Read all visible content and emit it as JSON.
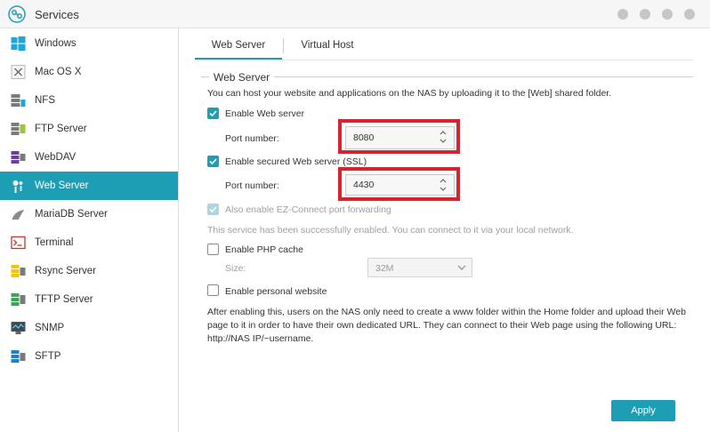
{
  "window": {
    "title": "Services"
  },
  "sidebar": {
    "items": [
      {
        "label": "Windows",
        "icon": "windows-icon"
      },
      {
        "label": "Mac OS X",
        "icon": "mac-os-x-icon"
      },
      {
        "label": "NFS",
        "icon": "nfs-icon"
      },
      {
        "label": "FTP Server",
        "icon": "ftp-server-icon"
      },
      {
        "label": "WebDAV",
        "icon": "webdav-icon"
      },
      {
        "label": "Web Server",
        "icon": "web-server-icon",
        "active": true
      },
      {
        "label": "MariaDB Server",
        "icon": "mariadb-icon"
      },
      {
        "label": "Terminal",
        "icon": "terminal-icon"
      },
      {
        "label": "Rsync Server",
        "icon": "rsync-server-icon"
      },
      {
        "label": "TFTP Server",
        "icon": "tftp-server-icon"
      },
      {
        "label": "SNMP",
        "icon": "snmp-icon"
      },
      {
        "label": "SFTP",
        "icon": "sftp-icon"
      }
    ]
  },
  "tabs": [
    {
      "label": "Web Server",
      "active": true
    },
    {
      "label": "Virtual Host",
      "active": false
    }
  ],
  "section": {
    "title": "Web Server",
    "intro": "You can host your website and applications on the NAS by uploading it to the [Web] shared folder."
  },
  "web_server": {
    "enable_label": "Enable Web server",
    "enabled": true,
    "port_label": "Port number:",
    "port": "8080"
  },
  "ssl": {
    "enable_label": "Enable secured Web server (SSL)",
    "enabled": true,
    "port_label": "Port number:",
    "port": "4430"
  },
  "ez_connect": {
    "label": "Also enable EZ-Connect port forwarding",
    "checked": true,
    "disabled": true
  },
  "status_message": "This service has been successfully enabled. You can connect to it via your local network.",
  "php_cache": {
    "label": "Enable PHP cache",
    "checked": false,
    "size_label": "Size:",
    "size_value": "32M"
  },
  "personal_website": {
    "label": "Enable personal website",
    "checked": false,
    "description_lines": [
      "After enabling this, users on the NAS only need to create a www folder within the Home folder and upload their Web",
      "page to it in order to have their own dedicated URL. They can connect to their Web page using the following URL:",
      "http://NAS IP/~username."
    ]
  },
  "apply_label": "Apply",
  "colors": {
    "accent": "#1e9eb5",
    "highlight": "#d8232f"
  }
}
